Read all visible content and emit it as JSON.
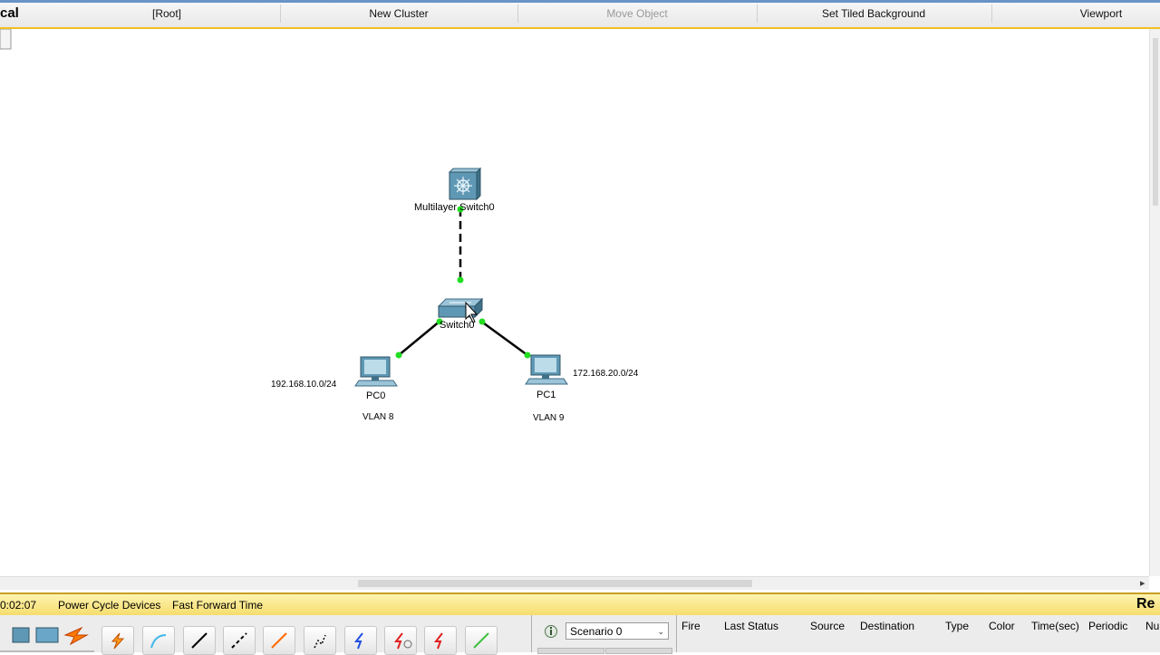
{
  "topbar": {
    "mode_label": "cal",
    "root_label": "[Root]",
    "new_cluster_label": "New Cluster",
    "move_object_label": "Move Object",
    "tiled_background_label": "Set Tiled Background",
    "viewport_label": "Viewport"
  },
  "topology": {
    "multilayer_switch_label": "Multilayer Switch0",
    "switch_label": "Switch0",
    "pc0_label": "PC0",
    "pc1_label": "PC1",
    "pc0_network": "192.168.10.0/24",
    "pc1_network": "172.168.20.0/24",
    "pc0_vlan": "VLAN 8",
    "pc1_vlan": "VLAN 9",
    "link_color": "#000000",
    "port_color": "#22dd22"
  },
  "statusbar": {
    "time": "0:02:07",
    "power_cycle_label": "Power Cycle Devices",
    "fast_forward_label": "Fast Forward Time",
    "realtime_label": "Re"
  },
  "bottom": {
    "scenario_value": "Scenario 0",
    "pdu_columns": [
      "Fire",
      "Last Status",
      "Source",
      "Destination",
      "Type",
      "Color",
      "Time(sec)",
      "Periodic",
      "Nu"
    ]
  }
}
